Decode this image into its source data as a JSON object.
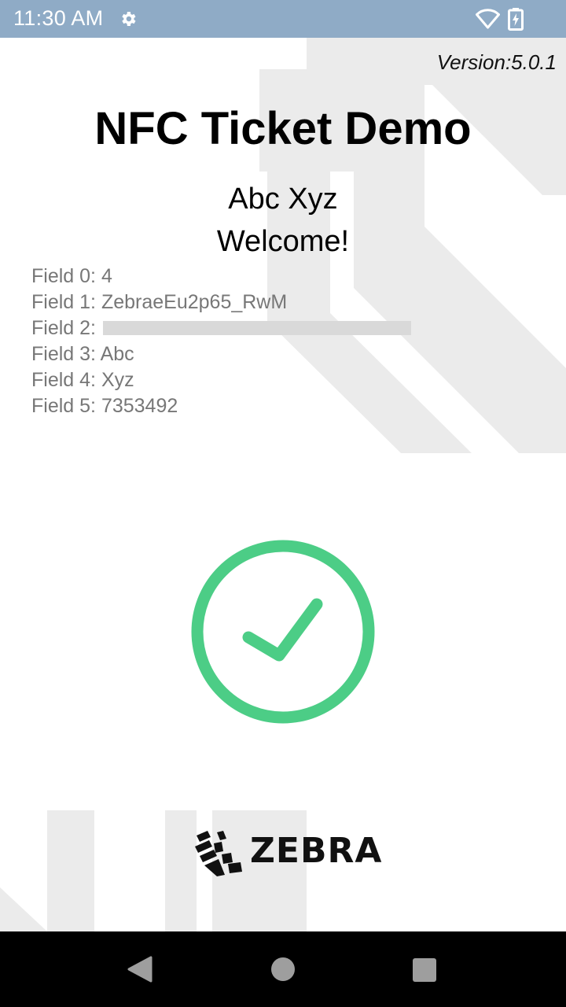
{
  "status_bar": {
    "time": "11:30 AM",
    "icons": [
      "gear-icon",
      "wifi-icon",
      "battery-charging-icon"
    ]
  },
  "app": {
    "version": "Version:5.0.1",
    "title": "NFC Ticket Demo",
    "user_name": "Abc Xyz",
    "welcome": "Welcome!",
    "fields": [
      {
        "label": "Field 0: ",
        "value": "4"
      },
      {
        "label": "Field 1: ",
        "value": "ZebraeEu2p65_RwM"
      },
      {
        "label": "Field 2: ",
        "value": ""
      },
      {
        "label": "Field 3: ",
        "value": "Abc"
      },
      {
        "label": "Field 4: ",
        "value": "Xyz"
      },
      {
        "label": "Field 5: ",
        "value": "7353492"
      }
    ],
    "status_icon": "success-check-icon",
    "logo_text": "ZEBRA"
  },
  "colors": {
    "status_bar": "#8fabc6",
    "success_green": "#4ccd86",
    "field_text": "#777777",
    "nav_bar": "#000000"
  },
  "nav_bar": {
    "buttons": [
      "back-icon",
      "home-icon",
      "recents-icon"
    ]
  }
}
